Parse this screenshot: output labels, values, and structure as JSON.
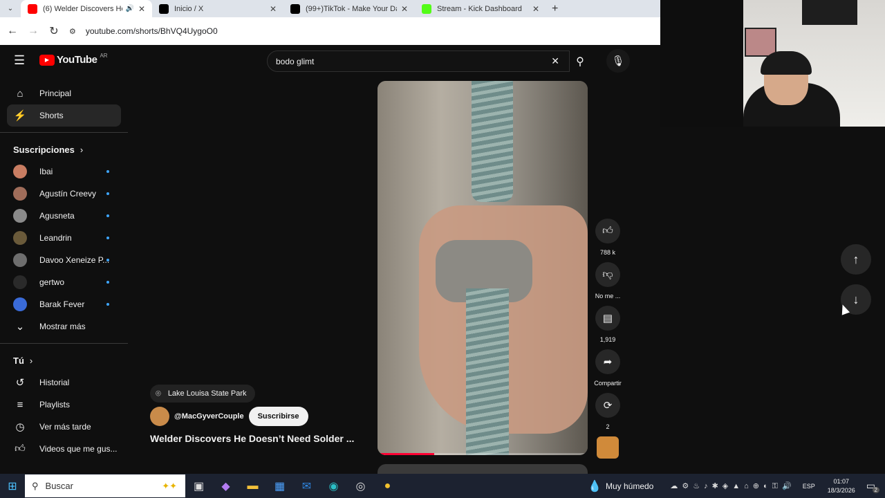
{
  "browser": {
    "tabs": [
      {
        "title": "(6) Welder Discovers He Do",
        "color": "#ff0000"
      },
      {
        "title": "Inicio / X",
        "color": "#000000"
      },
      {
        "title": "(99+)TikTok - Make Your Day",
        "color": "#000000"
      },
      {
        "title": "Stream - Kick Dashboard",
        "color": "#53fc18"
      }
    ],
    "url": "youtube.com/shorts/BhVQ4UygoO0"
  },
  "header": {
    "logo_text": "YouTube",
    "country": "AR",
    "search_value": "bodo glimt"
  },
  "sidebar": {
    "principal": "Principal",
    "shorts": "Shorts",
    "subscriptions_title": "Suscripciones",
    "subscriptions": [
      {
        "name": "Ibai",
        "color": "#c97d62"
      },
      {
        "name": "Agustín Creevy",
        "color": "#a06d5a"
      },
      {
        "name": "Agusneta",
        "color": "#8a8a8a"
      },
      {
        "name": "Leandrin",
        "color": "#6a5a3a"
      },
      {
        "name": "Davoo Xeneize P...",
        "color": "#6e6e6e"
      },
      {
        "name": "gertwo",
        "color": "#2a2a2a"
      },
      {
        "name": "Barak Fever",
        "color": "#3a6bd8"
      }
    ],
    "show_more": "Mostrar más",
    "you_title": "Tú",
    "you_items": [
      "Historial",
      "Playlists",
      "Ver más tarde",
      "Videos que me gus..."
    ]
  },
  "short": {
    "location": "Lake Louisa State Park",
    "channel": "@MacGyverCouple",
    "subscribe": "Suscribirse",
    "title": "Welder Discovers He Doesn’t Need Solder ...",
    "likes": "788 k",
    "dislike_label": "No me ...",
    "comments": "1,919",
    "share_label": "Compartir",
    "remix_count": "2",
    "progress": 0.27
  },
  "taskbar": {
    "search_placeholder": "Buscar",
    "weather": "Muy húmedo",
    "lang": "ESP",
    "time": "01:07",
    "date": "18/3/2026",
    "notif_count": "2"
  }
}
